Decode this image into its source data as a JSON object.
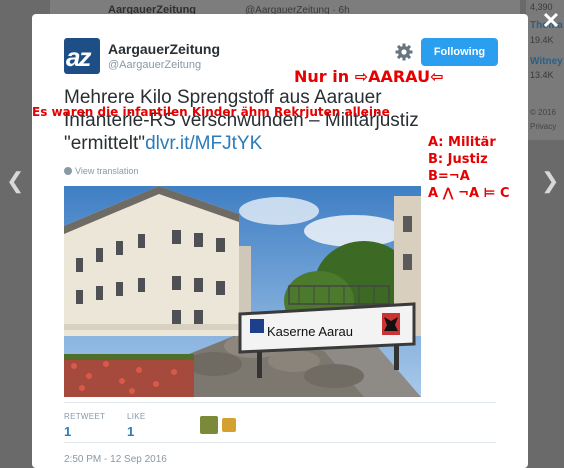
{
  "background": {
    "tweet_title": "AargauerZeitung",
    "tweet_sub": "@AargauerZeitung · 6h",
    "right_numbers": [
      "4,390",
      "19.4K",
      "13.4K"
    ],
    "right_links": [
      "Thoma",
      "Witney"
    ],
    "footer": [
      "© 2016",
      "Privacy"
    ]
  },
  "modal": {
    "author": {
      "avatar_text": "az",
      "name": "AargauerZeitung",
      "handle": "@AargauerZeitung"
    },
    "follow_label": "Following",
    "tweet": {
      "text": "Mehrere Kilo Sprengstoff aus Aarauer Infanterie-RS verschwunden – Militärjustiz \"ermittelt\"",
      "link": "dlvr.it/MFJtYK"
    },
    "view_translation": "View translation",
    "photo": {
      "sign_text": "Kaserne Aarau"
    },
    "stats": {
      "retweets_label": "RETWEET",
      "retweets_value": "1",
      "likes_label": "LIKE",
      "likes_value": "1"
    },
    "timestamp": "2:50 PM - 12 Sep 2016"
  },
  "overlays": {
    "nur_in": "Nur in ⇨AARAU⇦",
    "kinder": "Es waren die infantilen Kinder ähm Rekrjuten alleine",
    "logic_lines": [
      "A: Militär",
      "B: Justiz",
      "B=¬A",
      "A ⋀ ¬A ⊨ C"
    ]
  },
  "colors": {
    "brand_blue": "#1d4f86",
    "follow_blue": "#2b9ef0",
    "link_blue": "#2b7bb9",
    "overlay_red": "#e60000"
  },
  "icons": {
    "gear": "gear-icon",
    "close": "close-icon",
    "prev": "chevron-left-icon",
    "next": "chevron-right-icon",
    "globe": "globe-icon"
  }
}
